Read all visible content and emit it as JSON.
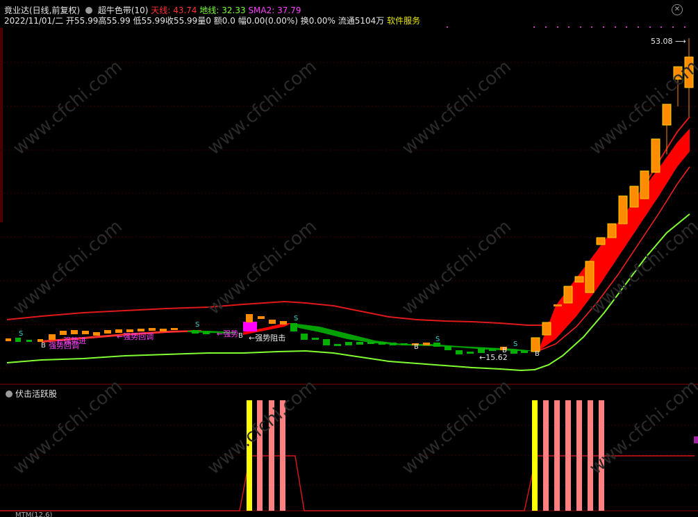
{
  "header": {
    "stock_name": "竟业达(日线,前复权)",
    "indicator_name": "超牛色带(10)",
    "tianxian_label": "天线:",
    "tianxian_value": "43.74",
    "dixian_label": "地线:",
    "dixian_value": "32.33",
    "sma2_label": "SMA2:",
    "sma2_value": "37.79",
    "date": "2022/11/01/二",
    "open": "开55.99",
    "high": "高55.99",
    "low": "低55.99",
    "close": "收55.99",
    "vol": "量0",
    "amount": "额0.0",
    "amp": "幅0.00(0.00%)",
    "turnover": "换0.00%",
    "float": "流通5104万",
    "service": "软件服务"
  },
  "annotations": {
    "high_price": "53.08",
    "low_price": "←15.62",
    "s_label": "S",
    "b_label": "B",
    "strong_pullback": "强势回调",
    "strong_pullback_arrow": "←强势回调",
    "strong_block": "←强势阻击",
    "strong_entry": "←强势进",
    "strong_short": "←强势"
  },
  "subpanel": {
    "title": "伏击活跃股",
    "bottom_label": "MTM(12,6)"
  },
  "watermark": "www.cfchi.com",
  "colors": {
    "background": "#000000",
    "up": "#ff8c00",
    "down": "#00b000",
    "tianxian": "#ff2020",
    "dixian": "#80ff30",
    "band": "#ff0000",
    "signal_yellow": "#ffff00",
    "signal_pink": "#ff8080"
  }
}
